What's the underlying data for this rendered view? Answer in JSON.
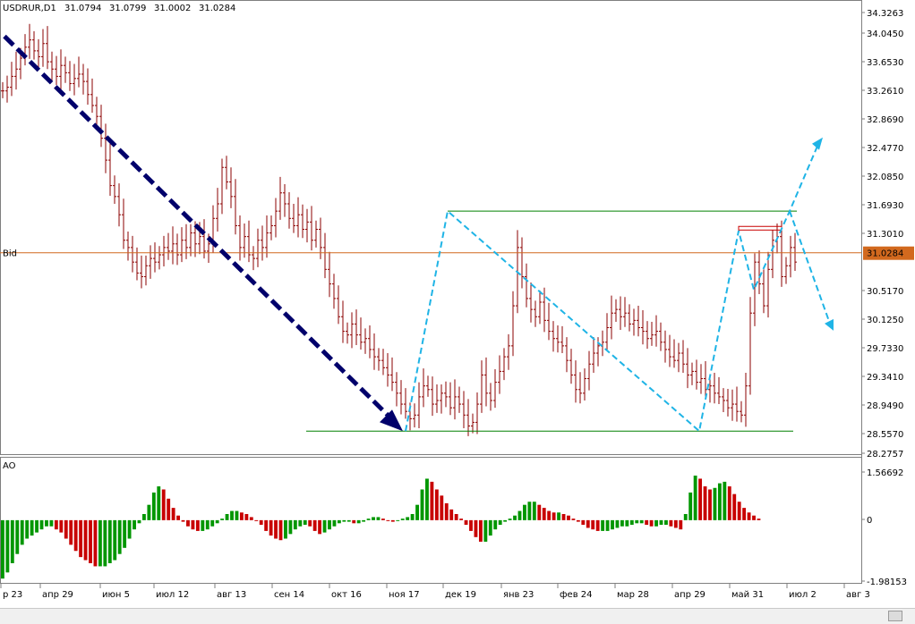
{
  "header": {
    "symbol": "USDRUR,D1",
    "open": "31.0794",
    "high": "31.0799",
    "low": "31.0002",
    "close": "31.0284"
  },
  "bid_label": "Bid",
  "oscillator_label": "AO",
  "colors": {
    "bullish_bar": "#009600",
    "bearish_bar": "#c80000",
    "price_bars": "#8b0000",
    "bid_line": "#d2691e",
    "support_line": "#008000",
    "trend_arrow": "#00006b",
    "projection_lines": "#1fb4e6",
    "rectangle": "#c80000"
  },
  "chart_data": [
    {
      "type": "ohlc",
      "title": "USDRUR,D1",
      "y_tick_labels": [
        "34.3263",
        "34.0450",
        "33.6530",
        "33.2610",
        "32.8690",
        "32.4770",
        "32.0850",
        "31.6930",
        "31.3010",
        "31.0284",
        "30.5170",
        "30.1250",
        "29.7330",
        "29.3410",
        "28.9490",
        "28.5570",
        "28.2757"
      ],
      "ylim": [
        28.2757,
        34.3263
      ],
      "x_tick_labels": [
        "р 23",
        "апр 29",
        "июн 5",
        "июл 12",
        "авг 13",
        "сен 14",
        "окт 16",
        "ноя 17",
        "дек 19",
        "янв 23",
        "фев 24",
        "мар 28",
        "апр 29",
        "май 31",
        "июл 2",
        "авг 3"
      ],
      "current_bid": 31.0284,
      "closes": [
        33.25,
        33.3,
        33.45,
        33.55,
        33.7,
        33.85,
        33.95,
        33.8,
        33.72,
        33.9,
        33.65,
        33.55,
        33.45,
        33.6,
        33.5,
        33.35,
        33.42,
        33.48,
        33.38,
        33.2,
        33.05,
        32.9,
        32.6,
        32.3,
        31.95,
        31.8,
        31.55,
        31.2,
        31.1,
        30.9,
        30.75,
        30.7,
        30.85,
        30.95,
        30.9,
        31.0,
        31.1,
        31.05,
        31.15,
        31.0,
        31.2,
        31.1,
        31.3,
        31.15,
        31.25,
        31.05,
        31.15,
        31.5,
        31.7,
        32.2,
        32.0,
        31.8,
        31.4,
        31.1,
        31.25,
        31.0,
        30.95,
        31.2,
        31.1,
        31.3,
        31.4,
        31.6,
        31.85,
        31.7,
        31.5,
        31.4,
        31.55,
        31.35,
        31.45,
        31.2,
        31.35,
        31.1,
        30.8,
        30.6,
        30.4,
        30.15,
        29.95,
        29.9,
        30.05,
        29.9,
        29.8,
        29.85,
        29.7,
        29.6,
        29.55,
        29.45,
        29.35,
        29.25,
        29.1,
        28.95,
        28.85,
        28.75,
        28.8,
        29.05,
        29.2,
        29.15,
        28.95,
        29.0,
        29.1,
        29.05,
        28.9,
        29.05,
        28.95,
        28.8,
        28.65,
        28.7,
        28.95,
        29.35,
        29.1,
        29.0,
        29.25,
        29.4,
        29.6,
        29.75,
        30.3,
        31.1,
        30.7,
        30.4,
        30.25,
        30.15,
        30.35,
        30.1,
        29.95,
        29.85,
        29.8,
        29.75,
        29.55,
        29.35,
        29.15,
        29.1,
        29.3,
        29.5,
        29.65,
        29.75,
        29.8,
        30.0,
        30.2,
        30.25,
        30.15,
        30.2,
        30.05,
        30.1,
        30.0,
        29.95,
        29.85,
        29.9,
        29.95,
        29.8,
        29.7,
        29.6,
        29.55,
        29.65,
        29.5,
        29.35,
        29.4,
        29.25,
        29.3,
        29.15,
        29.2,
        29.1,
        29.05,
        29.0,
        28.9,
        28.95,
        28.85,
        28.8,
        29.2,
        30.2,
        30.9,
        30.6,
        30.3,
        30.8,
        31.2,
        31.25,
        30.7,
        30.85,
        31.1,
        30.9
      ],
      "annotations": {
        "support_level": 28.58,
        "resistance_level": 31.6,
        "rectangle_range": [
          31.34,
          31.39
        ],
        "downtrend_arrow": {
          "from": 34.0,
          "to": 28.58
        },
        "projection_path": [
          28.58,
          31.6,
          28.58,
          31.33,
          30.52,
          31.6,
          32.55
        ],
        "projection_branch": [
          31.6,
          30.02
        ]
      }
    },
    {
      "type": "bar",
      "title": "AO",
      "y_tick_labels": [
        "1.56692",
        "0",
        "-1.98153"
      ],
      "ylim": [
        -1.98153,
        1.56692
      ],
      "values": [
        -1.9,
        -1.7,
        -1.4,
        -1.1,
        -0.8,
        -0.6,
        -0.5,
        -0.4,
        -0.3,
        -0.2,
        -0.2,
        -0.3,
        -0.4,
        -0.6,
        -0.8,
        -1.0,
        -1.2,
        -1.3,
        -1.4,
        -1.5,
        -1.5,
        -1.5,
        -1.4,
        -1.3,
        -1.1,
        -0.9,
        -0.6,
        -0.3,
        -0.1,
        0.2,
        0.5,
        0.9,
        1.1,
        1.0,
        0.7,
        0.4,
        0.15,
        -0.05,
        -0.2,
        -0.3,
        -0.35,
        -0.35,
        -0.3,
        -0.2,
        -0.1,
        0.05,
        0.2,
        0.3,
        0.3,
        0.25,
        0.2,
        0.1,
        0.0,
        -0.15,
        -0.35,
        -0.5,
        -0.6,
        -0.65,
        -0.6,
        -0.45,
        -0.3,
        -0.2,
        -0.15,
        -0.2,
        -0.35,
        -0.45,
        -0.4,
        -0.3,
        -0.2,
        -0.1,
        -0.05,
        -0.05,
        -0.1,
        -0.1,
        -0.05,
        0.05,
        0.1,
        0.1,
        0.05,
        0.0,
        -0.05,
        0.0,
        0.05,
        0.1,
        0.2,
        0.5,
        1.0,
        1.35,
        1.25,
        1.0,
        0.8,
        0.55,
        0.35,
        0.2,
        0.05,
        -0.15,
        -0.35,
        -0.55,
        -0.7,
        -0.7,
        -0.5,
        -0.3,
        -0.15,
        -0.05,
        0.05,
        0.15,
        0.3,
        0.5,
        0.6,
        0.6,
        0.5,
        0.4,
        0.3,
        0.25,
        0.25,
        0.2,
        0.15,
        0.05,
        -0.05,
        -0.15,
        -0.25,
        -0.3,
        -0.35,
        -0.35,
        -0.35,
        -0.3,
        -0.25,
        -0.2,
        -0.2,
        -0.15,
        -0.1,
        -0.1,
        -0.15,
        -0.2,
        -0.2,
        -0.15,
        -0.15,
        -0.2,
        -0.25,
        -0.3,
        0.2,
        0.9,
        1.45,
        1.35,
        1.1,
        1.0,
        1.05,
        1.2,
        1.25,
        1.1,
        0.85,
        0.6,
        0.4,
        0.25,
        0.15,
        0.05
      ]
    }
  ]
}
